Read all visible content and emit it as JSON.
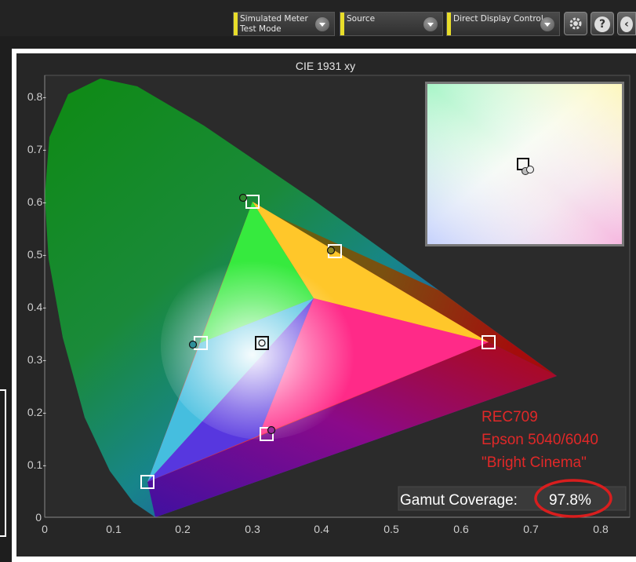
{
  "toolbar": {
    "simulated_meter_line1": "Simulated Meter",
    "simulated_meter_line2": "Test Mode",
    "source_label": "Source",
    "direct_display_label": "Direct Display Control",
    "settings_icon": "gear-icon",
    "help_icon": "question-icon",
    "back_icon": "chevron-left-icon",
    "help_glyph": "?",
    "back_glyph": "‹"
  },
  "chart": {
    "title": "CIE 1931 xy",
    "x_ticks": [
      "0",
      "0.1",
      "0.2",
      "0.3",
      "0.4",
      "0.5",
      "0.6",
      "0.7",
      "0.8"
    ],
    "y_ticks": [
      "0",
      "0.1-",
      "0.2-",
      "0.3-",
      "0.4-",
      "0.5-",
      "0.6-",
      "0.7-",
      "0.8-"
    ],
    "annotation_line1": "REC709",
    "annotation_line2": "Epson 5040/6040",
    "annotation_line3": "\"Bright Cinema\"",
    "coverage_label": "Gamut Coverage:",
    "coverage_value": "97.8%"
  },
  "chart_data": {
    "type": "scatter",
    "title": "CIE 1931 xy",
    "xlim": [
      0,
      0.8
    ],
    "ylim": [
      0,
      0.85
    ],
    "series": [
      {
        "name": "REC709",
        "points": [
          [
            0.64,
            0.33
          ],
          [
            0.3,
            0.6
          ],
          [
            0.15,
            0.06
          ],
          [
            0.225,
            0.33
          ],
          [
            0.321,
            0.154
          ],
          [
            0.419,
            0.505
          ],
          [
            0.3127,
            0.329
          ]
        ]
      },
      {
        "name": "Epson 5040/6040",
        "points": [
          [
            0.289,
            0.607
          ],
          [
            0.415,
            0.508
          ],
          [
            0.213,
            0.328
          ],
          [
            0.327,
            0.164
          ],
          [
            0.313,
            0.329
          ],
          [
            0.64,
            0.33
          ]
        ]
      }
    ],
    "gamut_coverage": "97.8%"
  }
}
